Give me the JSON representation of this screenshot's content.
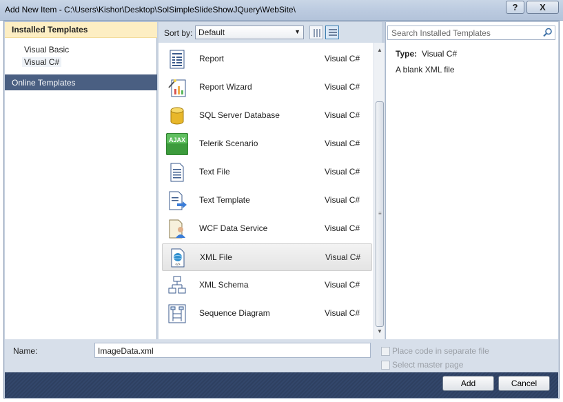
{
  "window": {
    "title": "Add New Item - C:\\Users\\Kishor\\Desktop\\SolSimpleSlideShowJQuery\\WebSite\\",
    "help_glyph": "?",
    "close_glyph": "X"
  },
  "left": {
    "header": "Installed Templates",
    "items": [
      {
        "label": "Visual Basic"
      },
      {
        "label": "Visual C#"
      }
    ],
    "online": "Online Templates"
  },
  "toolbar": {
    "sort_label": "Sort by:",
    "sort_value": "Default"
  },
  "templates": [
    {
      "name": "Report",
      "lang": "Visual C#",
      "icon": "report-icon"
    },
    {
      "name": "Report Wizard",
      "lang": "Visual C#",
      "icon": "report-wizard-icon"
    },
    {
      "name": "SQL Server Database",
      "lang": "Visual C#",
      "icon": "database-icon"
    },
    {
      "name": "Telerik Scenario",
      "lang": "Visual C#",
      "icon": "ajax-icon",
      "badge": "AJAX"
    },
    {
      "name": "Text File",
      "lang": "Visual C#",
      "icon": "text-file-icon"
    },
    {
      "name": "Text Template",
      "lang": "Visual C#",
      "icon": "text-template-icon"
    },
    {
      "name": "WCF Data Service",
      "lang": "Visual C#",
      "icon": "wcf-service-icon"
    },
    {
      "name": "XML File",
      "lang": "Visual C#",
      "icon": "xml-file-icon",
      "selected": true
    },
    {
      "name": "XML Schema",
      "lang": "Visual C#",
      "icon": "xml-schema-icon"
    },
    {
      "name": "Sequence Diagram",
      "lang": "Visual C#",
      "icon": "sequence-diagram-icon"
    }
  ],
  "details": {
    "search_placeholder": "Search Installed Templates",
    "type_label": "Type:",
    "type_value": "Visual C#",
    "description": "A blank XML file"
  },
  "bottom": {
    "name_label": "Name:",
    "name_value": "ImageData.xml",
    "place_code": "Place code in separate file",
    "master_page": "Select master page"
  },
  "buttons": {
    "add": "Add",
    "cancel": "Cancel"
  }
}
